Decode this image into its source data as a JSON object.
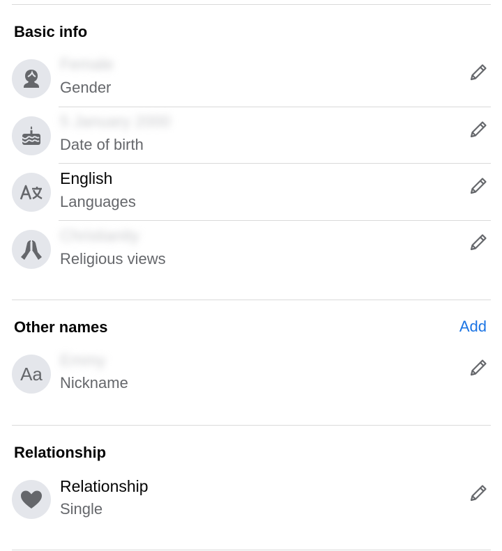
{
  "basic_info": {
    "title": "Basic info",
    "items": [
      {
        "value": "Female",
        "label": "Gender",
        "icon": "gender-icon"
      },
      {
        "value": "5 January 2000",
        "label": "Date of birth",
        "icon": "cake-icon"
      },
      {
        "value": "English",
        "label": "Languages",
        "icon": "translate-icon"
      },
      {
        "value": "Christianity",
        "label": "Religious views",
        "icon": "praying-hands-icon"
      }
    ]
  },
  "other_names": {
    "title": "Other names",
    "add_label": "Add",
    "items": [
      {
        "value": "Emmy",
        "label": "Nickname",
        "icon": "font-aa-icon",
        "icon_text": "Aa"
      }
    ]
  },
  "relationship": {
    "title": "Relationship",
    "items": [
      {
        "value": "Relationship",
        "label": "Single",
        "icon": "heart-icon"
      }
    ]
  },
  "colors": {
    "accent": "#1b74e4",
    "icon_bg": "#e4e6eb",
    "icon_fg": "#65676b",
    "secondary_text": "#65676b",
    "divider": "#d9d9d9"
  }
}
